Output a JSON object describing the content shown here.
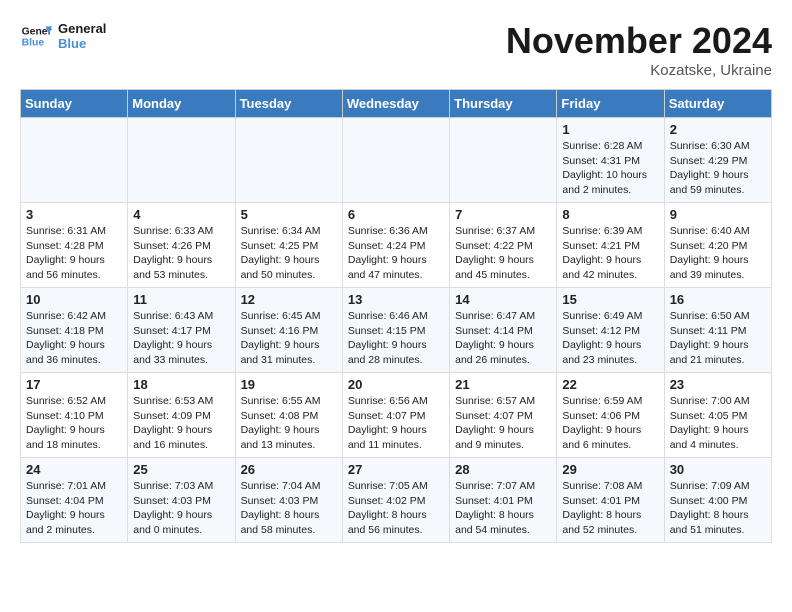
{
  "header": {
    "logo_general": "General",
    "logo_blue": "Blue",
    "month_title": "November 2024",
    "location": "Kozatske, Ukraine"
  },
  "weekdays": [
    "Sunday",
    "Monday",
    "Tuesday",
    "Wednesday",
    "Thursday",
    "Friday",
    "Saturday"
  ],
  "weeks": [
    [
      {
        "day": "",
        "info": ""
      },
      {
        "day": "",
        "info": ""
      },
      {
        "day": "",
        "info": ""
      },
      {
        "day": "",
        "info": ""
      },
      {
        "day": "",
        "info": ""
      },
      {
        "day": "1",
        "info": "Sunrise: 6:28 AM\nSunset: 4:31 PM\nDaylight: 10 hours and 2 minutes."
      },
      {
        "day": "2",
        "info": "Sunrise: 6:30 AM\nSunset: 4:29 PM\nDaylight: 9 hours and 59 minutes."
      }
    ],
    [
      {
        "day": "3",
        "info": "Sunrise: 6:31 AM\nSunset: 4:28 PM\nDaylight: 9 hours and 56 minutes."
      },
      {
        "day": "4",
        "info": "Sunrise: 6:33 AM\nSunset: 4:26 PM\nDaylight: 9 hours and 53 minutes."
      },
      {
        "day": "5",
        "info": "Sunrise: 6:34 AM\nSunset: 4:25 PM\nDaylight: 9 hours and 50 minutes."
      },
      {
        "day": "6",
        "info": "Sunrise: 6:36 AM\nSunset: 4:24 PM\nDaylight: 9 hours and 47 minutes."
      },
      {
        "day": "7",
        "info": "Sunrise: 6:37 AM\nSunset: 4:22 PM\nDaylight: 9 hours and 45 minutes."
      },
      {
        "day": "8",
        "info": "Sunrise: 6:39 AM\nSunset: 4:21 PM\nDaylight: 9 hours and 42 minutes."
      },
      {
        "day": "9",
        "info": "Sunrise: 6:40 AM\nSunset: 4:20 PM\nDaylight: 9 hours and 39 minutes."
      }
    ],
    [
      {
        "day": "10",
        "info": "Sunrise: 6:42 AM\nSunset: 4:18 PM\nDaylight: 9 hours and 36 minutes."
      },
      {
        "day": "11",
        "info": "Sunrise: 6:43 AM\nSunset: 4:17 PM\nDaylight: 9 hours and 33 minutes."
      },
      {
        "day": "12",
        "info": "Sunrise: 6:45 AM\nSunset: 4:16 PM\nDaylight: 9 hours and 31 minutes."
      },
      {
        "day": "13",
        "info": "Sunrise: 6:46 AM\nSunset: 4:15 PM\nDaylight: 9 hours and 28 minutes."
      },
      {
        "day": "14",
        "info": "Sunrise: 6:47 AM\nSunset: 4:14 PM\nDaylight: 9 hours and 26 minutes."
      },
      {
        "day": "15",
        "info": "Sunrise: 6:49 AM\nSunset: 4:12 PM\nDaylight: 9 hours and 23 minutes."
      },
      {
        "day": "16",
        "info": "Sunrise: 6:50 AM\nSunset: 4:11 PM\nDaylight: 9 hours and 21 minutes."
      }
    ],
    [
      {
        "day": "17",
        "info": "Sunrise: 6:52 AM\nSunset: 4:10 PM\nDaylight: 9 hours and 18 minutes."
      },
      {
        "day": "18",
        "info": "Sunrise: 6:53 AM\nSunset: 4:09 PM\nDaylight: 9 hours and 16 minutes."
      },
      {
        "day": "19",
        "info": "Sunrise: 6:55 AM\nSunset: 4:08 PM\nDaylight: 9 hours and 13 minutes."
      },
      {
        "day": "20",
        "info": "Sunrise: 6:56 AM\nSunset: 4:07 PM\nDaylight: 9 hours and 11 minutes."
      },
      {
        "day": "21",
        "info": "Sunrise: 6:57 AM\nSunset: 4:07 PM\nDaylight: 9 hours and 9 minutes."
      },
      {
        "day": "22",
        "info": "Sunrise: 6:59 AM\nSunset: 4:06 PM\nDaylight: 9 hours and 6 minutes."
      },
      {
        "day": "23",
        "info": "Sunrise: 7:00 AM\nSunset: 4:05 PM\nDaylight: 9 hours and 4 minutes."
      }
    ],
    [
      {
        "day": "24",
        "info": "Sunrise: 7:01 AM\nSunset: 4:04 PM\nDaylight: 9 hours and 2 minutes."
      },
      {
        "day": "25",
        "info": "Sunrise: 7:03 AM\nSunset: 4:03 PM\nDaylight: 9 hours and 0 minutes."
      },
      {
        "day": "26",
        "info": "Sunrise: 7:04 AM\nSunset: 4:03 PM\nDaylight: 8 hours and 58 minutes."
      },
      {
        "day": "27",
        "info": "Sunrise: 7:05 AM\nSunset: 4:02 PM\nDaylight: 8 hours and 56 minutes."
      },
      {
        "day": "28",
        "info": "Sunrise: 7:07 AM\nSunset: 4:01 PM\nDaylight: 8 hours and 54 minutes."
      },
      {
        "day": "29",
        "info": "Sunrise: 7:08 AM\nSunset: 4:01 PM\nDaylight: 8 hours and 52 minutes."
      },
      {
        "day": "30",
        "info": "Sunrise: 7:09 AM\nSunset: 4:00 PM\nDaylight: 8 hours and 51 minutes."
      }
    ]
  ]
}
